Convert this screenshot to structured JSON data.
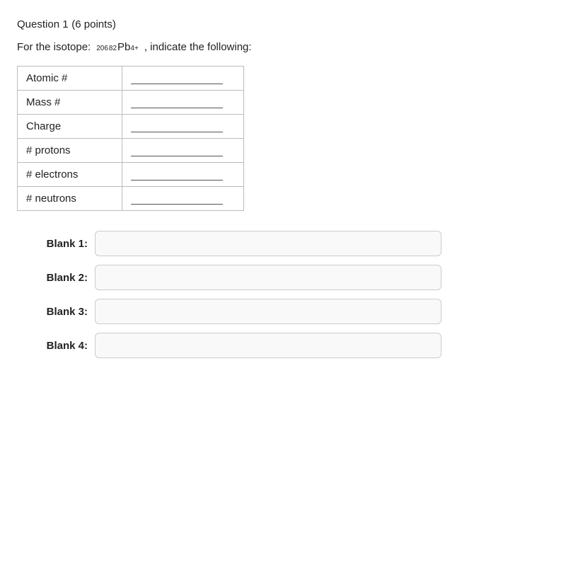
{
  "question": {
    "title": "Question 1",
    "points": "(6 points)",
    "intro": "For the isotope:",
    "isotope": {
      "mass_number": "206",
      "atomic_number": "82",
      "element": "Pb",
      "charge": "4+"
    },
    "suffix": ", indicate the following:",
    "table": {
      "rows": [
        {
          "label": "Atomic #",
          "answer": ""
        },
        {
          "label": "Mass #",
          "answer": ""
        },
        {
          "label": "Charge",
          "answer": ""
        },
        {
          "label": "# protons",
          "answer": ""
        },
        {
          "label": "# electrons",
          "answer": ""
        },
        {
          "label": "# neutrons",
          "answer": ""
        }
      ]
    },
    "blanks": [
      {
        "id": "blank1",
        "label": "Blank 1:",
        "placeholder": ""
      },
      {
        "id": "blank2",
        "label": "Blank 2:",
        "placeholder": ""
      },
      {
        "id": "blank3",
        "label": "Blank 3:",
        "placeholder": ""
      },
      {
        "id": "blank4",
        "label": "Blank 4:",
        "placeholder": ""
      }
    ]
  }
}
